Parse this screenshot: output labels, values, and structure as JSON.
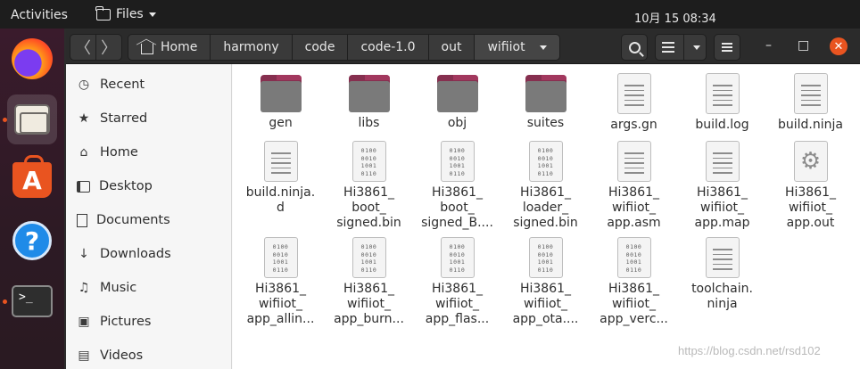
{
  "topbar": {
    "activities": "Activities",
    "app_name": "Files",
    "clock": "10月 15  08:34"
  },
  "dock": {
    "items": [
      {
        "name": "firefox",
        "icon": "firefox-icon"
      },
      {
        "name": "files",
        "icon": "files-icon"
      },
      {
        "name": "software",
        "icon": "store-icon"
      },
      {
        "name": "help",
        "icon": "help-icon"
      },
      {
        "name": "terminal",
        "icon": "terminal-icon"
      }
    ],
    "help_glyph": "?",
    "store_glyph": "A",
    "terminal_glyph": ">_"
  },
  "header": {
    "back_glyph": "〈",
    "forward_glyph": "〉",
    "breadcrumbs": [
      "Home",
      "harmony",
      "code",
      "code-1.0",
      "out",
      "wifiiot"
    ],
    "minimize_glyph": "–",
    "maximize_glyph": "□",
    "close_glyph": "✕"
  },
  "sidebar": {
    "items": [
      {
        "label": "Recent",
        "icon": "clock-icon"
      },
      {
        "label": "Starred",
        "icon": "star-icon"
      },
      {
        "label": "Home",
        "icon": "home-icon"
      },
      {
        "label": "Desktop",
        "icon": "desktop-icon"
      },
      {
        "label": "Documents",
        "icon": "document-icon"
      },
      {
        "label": "Downloads",
        "icon": "download-icon"
      },
      {
        "label": "Music",
        "icon": "music-icon"
      },
      {
        "label": "Pictures",
        "icon": "picture-icon"
      },
      {
        "label": "Videos",
        "icon": "video-icon"
      }
    ],
    "glyphs": [
      "◷",
      "★",
      "⌂",
      "",
      "",
      "↓",
      "♫",
      "▣",
      "▤"
    ]
  },
  "files": [
    {
      "name": "gen",
      "type": "folder"
    },
    {
      "name": "libs",
      "type": "folder"
    },
    {
      "name": "obj",
      "type": "folder"
    },
    {
      "name": "suites",
      "type": "folder"
    },
    {
      "name": "args.gn",
      "type": "text"
    },
    {
      "name": "build.log",
      "type": "text"
    },
    {
      "name": "build.ninja",
      "type": "text"
    },
    {
      "name": "build.ninja.\nd",
      "type": "text"
    },
    {
      "name": "Hi3861_\nboot_\nsigned.bin",
      "type": "binary"
    },
    {
      "name": "Hi3861_\nboot_\nsigned_B....",
      "type": "binary"
    },
    {
      "name": "Hi3861_\nloader_\nsigned.bin",
      "type": "binary"
    },
    {
      "name": "Hi3861_\nwifiiot_\napp.asm",
      "type": "text"
    },
    {
      "name": "Hi3861_\nwifiiot_\napp.map",
      "type": "text"
    },
    {
      "name": "Hi3861_\nwifiiot_\napp.out",
      "type": "executable"
    },
    {
      "name": "Hi3861_\nwifiiot_\napp_allin...",
      "type": "binary"
    },
    {
      "name": "Hi3861_\nwifiiot_\napp_burn...",
      "type": "binary"
    },
    {
      "name": "Hi3861_\nwifiiot_\napp_flas...",
      "type": "binary"
    },
    {
      "name": "Hi3861_\nwifiiot_\napp_ota....",
      "type": "binary"
    },
    {
      "name": "Hi3861_\nwifiiot_\napp_verc...",
      "type": "binary"
    },
    {
      "name": "toolchain.\nninja",
      "type": "text"
    }
  ],
  "binary_glyph": "0100\n0010\n1001\n0110",
  "gear_glyph": "⚙",
  "watermark": "https://blog.csdn.net/rsd102"
}
